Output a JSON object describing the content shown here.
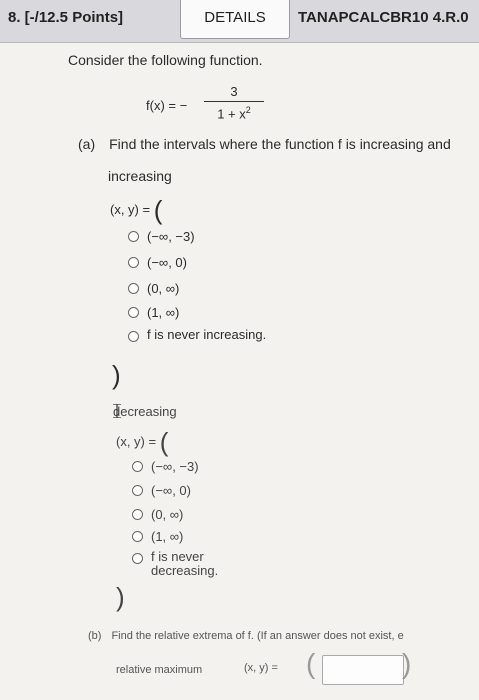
{
  "header": {
    "points": "8. [-/12.5 Points]",
    "details_label": "DETAILS",
    "problem_code": "TANAPCALCBR10 4.R.0"
  },
  "intro": "Consider the following function.",
  "function": {
    "lhs": "f(x) = −",
    "numerator": "3",
    "denominator_base": "1 + x",
    "denominator_exp": "2"
  },
  "part_a": {
    "label": "(a)",
    "prompt": "Find the intervals where the function f is increasing and",
    "increasing": {
      "label": "increasing",
      "xy": "(x, y) =",
      "options": [
        "(−∞, −3)",
        "(−∞, 0)",
        "(0, ∞)",
        "(1, ∞)",
        "f is never increasing."
      ]
    },
    "decreasing": {
      "label": "decreasing",
      "xy": "(x, y) =",
      "options": [
        "(−∞, −3)",
        "(−∞, 0)",
        "(0, ∞)",
        "(1, ∞)",
        "f is never decreasing."
      ]
    }
  },
  "part_b": {
    "label": "(b)",
    "prompt": "Find the relative extrema of f. (If an answer does not exist, e",
    "relmax_label": "relative maximum",
    "relmax_xy": "(x, y) =",
    "relmax_value": ""
  }
}
